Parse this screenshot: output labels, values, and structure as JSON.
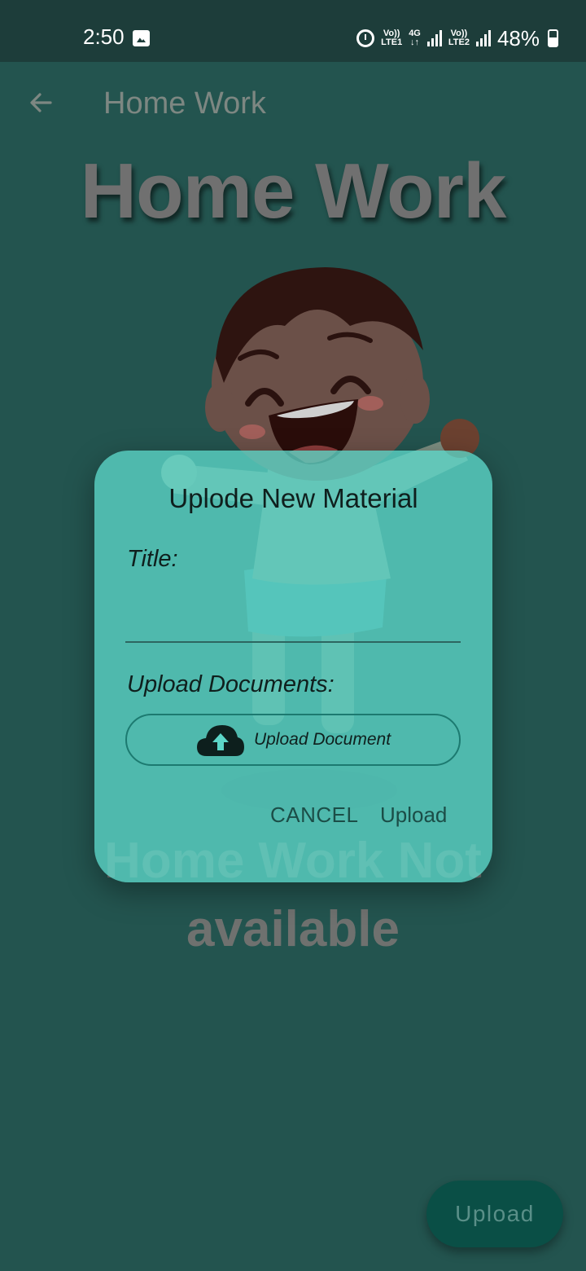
{
  "status_bar": {
    "time": "2:50",
    "sim1_label_top": "Vo))",
    "sim1_label_bottom": "LTE1",
    "network_top": "4G",
    "network_bottom": "↓↑",
    "sim2_label_top": "Vo))",
    "sim2_label_bottom": "LTE2",
    "battery": "48%",
    "icons": [
      "image-icon",
      "alarm-icon",
      "signal-icon",
      "battery-icon"
    ]
  },
  "app_bar": {
    "title": "Home Work",
    "back_icon": "arrow-left-icon"
  },
  "main": {
    "heading": "Home Work",
    "empty_state": "Home Work Not available"
  },
  "dialog": {
    "title": "Uplode New Material",
    "title_label": "Title:",
    "title_value": "",
    "upload_label": "Upload Documents:",
    "upload_document_button": "Upload Document",
    "cancel_button": "CANCEL",
    "upload_button": "Upload"
  },
  "fab": {
    "label": "Upload"
  },
  "colors": {
    "background": "#23544f",
    "status_bar": "#1d3d3a",
    "dialog": "#5cd6c8",
    "fab": "#0a4f46"
  }
}
